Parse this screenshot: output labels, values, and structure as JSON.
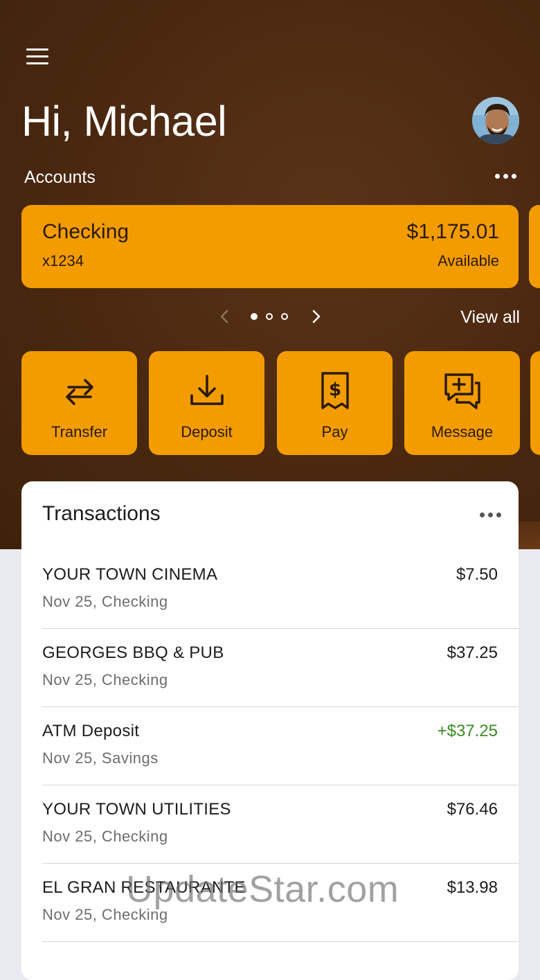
{
  "header": {
    "greeting": "Hi, Michael"
  },
  "accounts": {
    "label": "Accounts",
    "current": {
      "name": "Checking",
      "number": "x1234",
      "balance": "$1,175.01",
      "balance_label": "Available"
    },
    "pager": {
      "total": 3,
      "active": 1
    },
    "view_all": "View all"
  },
  "actions": [
    {
      "label": "Transfer",
      "icon": "transfer-icon"
    },
    {
      "label": "Deposit",
      "icon": "deposit-icon"
    },
    {
      "label": "Pay",
      "icon": "pay-icon"
    },
    {
      "label": "Message",
      "icon": "message-icon"
    }
  ],
  "transactions": {
    "title": "Transactions",
    "items": [
      {
        "name": "YOUR TOWN CINEMA",
        "meta": "Nov 25, Checking",
        "amount": "$7.50",
        "credit": false
      },
      {
        "name": "GEORGES BBQ & PUB",
        "meta": "Nov 25, Checking",
        "amount": "$37.25",
        "credit": false
      },
      {
        "name": "ATM Deposit",
        "meta": "Nov 25, Savings",
        "amount": "+$37.25",
        "credit": true
      },
      {
        "name": "YOUR TOWN UTILITIES",
        "meta": "Nov 25, Checking",
        "amount": "$76.46",
        "credit": false
      },
      {
        "name": "EL GRAN RESTAURANTE",
        "meta": "Nov 25, Checking",
        "amount": "$13.98",
        "credit": false
      }
    ]
  },
  "watermark": "UpdateStar.com",
  "colors": {
    "hero_bg": "#4a2810",
    "accent": "#f39c00",
    "credit": "#3b8a1f"
  }
}
